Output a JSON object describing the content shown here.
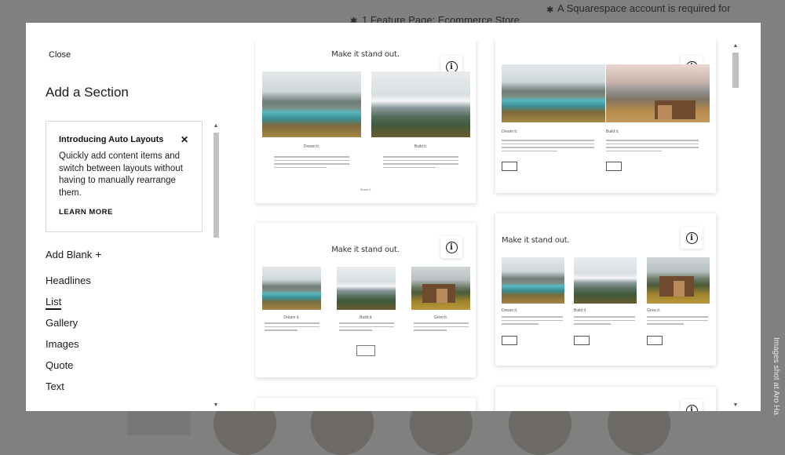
{
  "background": {
    "bullets": [
      {
        "text": "1 Feature Page: Ecommerce Store"
      },
      {
        "text": "A Squarespace account is required for"
      }
    ],
    "side_caption": "Images shot at Aro Ha"
  },
  "modal": {
    "close_label": "Close",
    "title": "Add a Section",
    "promo": {
      "title": "Introducing Auto Layouts",
      "close_glyph": "✕",
      "body": "Quickly add content items and switch between layouts without having to manually rearrange them.",
      "link": "LEARN MORE"
    },
    "add_blank": {
      "label": "Add Blank",
      "icon": "+"
    },
    "categories": [
      {
        "label": "Headlines",
        "active": false
      },
      {
        "label": "List",
        "active": true
      },
      {
        "label": "Gallery",
        "active": false
      },
      {
        "label": "Images",
        "active": false
      },
      {
        "label": "Quote",
        "active": false
      },
      {
        "label": "Text",
        "active": false
      }
    ],
    "previews": [
      {
        "heading": "Make it stand out.",
        "captions": [
          "Dream it.",
          "Build it."
        ],
        "link": "Share it"
      },
      {
        "heading": "",
        "captions": [
          "Dream it.",
          "Build it."
        ]
      },
      {
        "heading": "Make it stand out.",
        "captions": [
          "Dream it.",
          "Build it.",
          "Grow it."
        ]
      },
      {
        "heading": "Make it stand out.",
        "captions": [
          "Dream it.",
          "Build it.",
          "Grow it."
        ]
      }
    ],
    "info_icon": "i"
  },
  "colors": {
    "overlay": "#808080",
    "modal": "#ffffff",
    "text": "#1a1a1a",
    "scrollbar": "#c1c1c1"
  }
}
